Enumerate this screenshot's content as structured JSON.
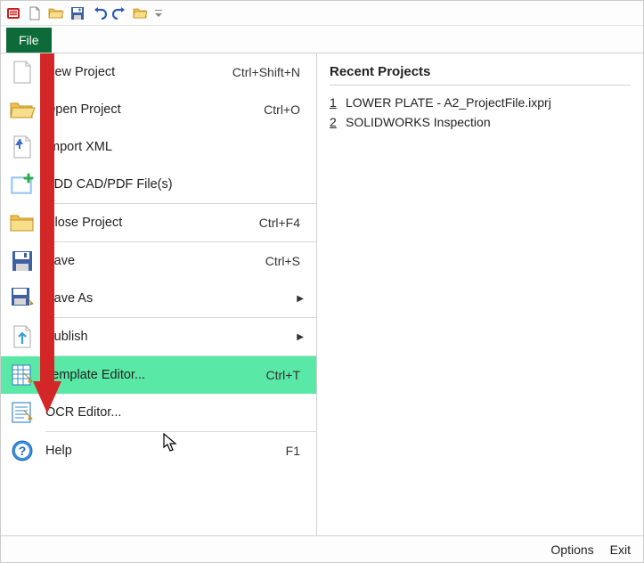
{
  "ribbon": {
    "file_tab": "File"
  },
  "menu": {
    "new_project": {
      "label": "New Project",
      "shortcut": "Ctrl+Shift+N"
    },
    "open_project": {
      "label": "Open Project",
      "shortcut": "Ctrl+O"
    },
    "import_xml": {
      "label": "Import XML",
      "shortcut": ""
    },
    "add_cad": {
      "label": "ADD CAD/PDF File(s)",
      "shortcut": ""
    },
    "close_project": {
      "label": "Close Project",
      "shortcut": "Ctrl+F4"
    },
    "save": {
      "label": "Save",
      "shortcut": "Ctrl+S"
    },
    "save_as": {
      "label": "Save As",
      "shortcut": ""
    },
    "publish": {
      "label": "Publish",
      "shortcut": ""
    },
    "template_editor": {
      "label": "Template Editor...",
      "shortcut": "Ctrl+T"
    },
    "ocr_editor": {
      "label": "OCR Editor...",
      "shortcut": ""
    },
    "help": {
      "label": "Help",
      "shortcut": "F1"
    }
  },
  "recent": {
    "title": "Recent Projects",
    "items": [
      {
        "num": "1",
        "label": "LOWER PLATE - A2_ProjectFile.ixprj"
      },
      {
        "num": "2",
        "label": "SOLIDWORKS Inspection"
      }
    ]
  },
  "footer": {
    "options": "Options",
    "exit": "Exit"
  }
}
